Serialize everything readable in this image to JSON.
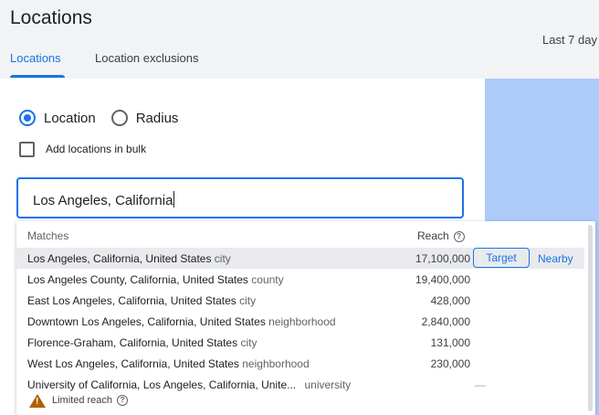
{
  "page": {
    "title": "Locations",
    "date_range": "Last 7 day"
  },
  "tabs": [
    {
      "label": "Locations",
      "active": true
    },
    {
      "label": "Location exclusions",
      "active": false
    }
  ],
  "targeting": {
    "mode_options": [
      {
        "label": "Location",
        "checked": true
      },
      {
        "label": "Radius",
        "checked": false
      }
    ],
    "bulk_label": "Add locations in bulk",
    "bulk_checked": false,
    "search_value": "Los Angeles, California"
  },
  "results": {
    "matches_header": "Matches",
    "reach_header": "Reach",
    "target_label": "Target",
    "nearby_label": "Nearby",
    "rows": [
      {
        "name": "Los Angeles, California, United States",
        "type": "city",
        "reach": "17,100,000"
      },
      {
        "name": "Los Angeles County, California, United States",
        "type": "county",
        "reach": "19,400,000"
      },
      {
        "name": "East Los Angeles, California, United States",
        "type": "city",
        "reach": "428,000"
      },
      {
        "name": "Downtown Los Angeles, California, United States",
        "type": "neighborhood",
        "reach": "2,840,000"
      },
      {
        "name": "Florence-Graham, California, United States",
        "type": "city",
        "reach": "131,000"
      },
      {
        "name": "West Los Angeles, California, United States",
        "type": "neighborhood",
        "reach": "230,000"
      },
      {
        "name": "University of California, Los Angeles, California, Unite...",
        "type": "university",
        "reach": "—"
      }
    ],
    "limited_reach_label": "Limited reach"
  },
  "colors": {
    "accent": "#1a73e8",
    "map": "#aecbfa",
    "warning": "#b06000"
  }
}
